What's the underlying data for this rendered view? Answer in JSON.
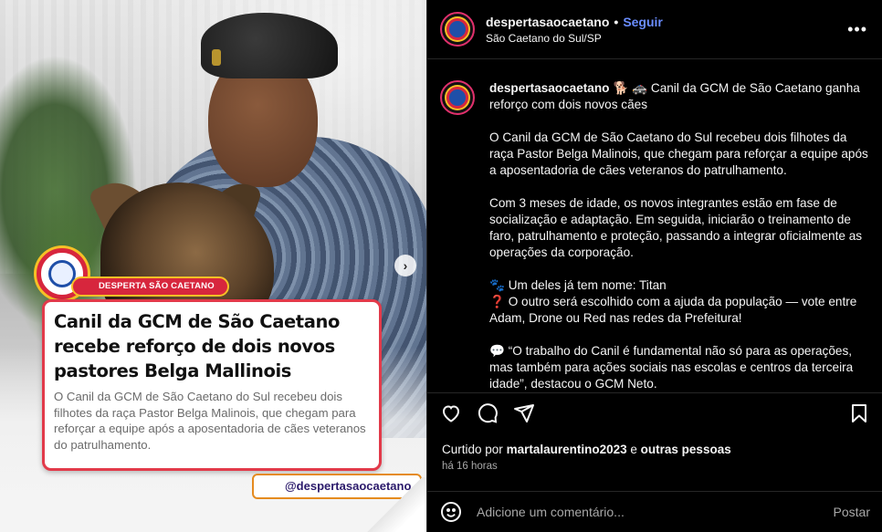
{
  "media": {
    "brand_pill": "DESPERTA SÃO CAETANO",
    "card_title": "Canil da GCM de São Caetano recebe reforço de dois novos pastores Belga Mallinois",
    "card_text": "O Canil da GCM de São Caetano do Sul recebeu dois filhotes da raça Pastor Belga Malinois, que chegam para reforçar a equipe após a aposentadoria de cães veteranos do patrulhamento.",
    "handle_tag": "@despertasaocaetano",
    "next_icon": "chevron-right-icon"
  },
  "header": {
    "username": "despertasaocaetano",
    "separator": "•",
    "follow_label": "Seguir",
    "location": "São Caetano do Sul/SP",
    "more_label": "•••"
  },
  "caption": {
    "username": "despertasaocaetano",
    "headline": "🐕 🚓 Canil da GCM de São Caetano ganha reforço com dois novos cães",
    "p1": "O Canil da GCM de São Caetano do Sul recebeu dois filhotes da raça Pastor Belga Malinois, que chegam para reforçar a equipe após a aposentadoria de cães veteranos do patrulhamento.",
    "p2": "Com 3 meses de idade, os novos integrantes estão em fase de socialização e adaptação. Em seguida, iniciarão o treinamento de faro, patrulhamento e proteção, passando a integrar oficialmente as operações da corporação.",
    "p3a": "🐾 Um deles já tem nome: Titan",
    "p3b": "❓ O outro será escolhido com a ajuda da população — vote entre Adam, Drone ou Red nas redes da Prefeitura!",
    "p4": "💬 “O trabalho do Canil é fundamental não só para as operações, mas também para ações sociais nas escolas e centros da terceira idade”, destacou o GCM Neto."
  },
  "likes": {
    "prefix": "Curtido por",
    "user": "martalaurentino2023",
    "conj": "e",
    "others": "outras pessoas"
  },
  "time": "há 16 horas",
  "comment": {
    "placeholder": "Adicione um comentário...",
    "post_label": "Postar"
  },
  "colors": {
    "background": "#000000",
    "follow": "#6a8dff",
    "brand_red": "#d7263d",
    "brand_yellow": "#f6c026"
  }
}
